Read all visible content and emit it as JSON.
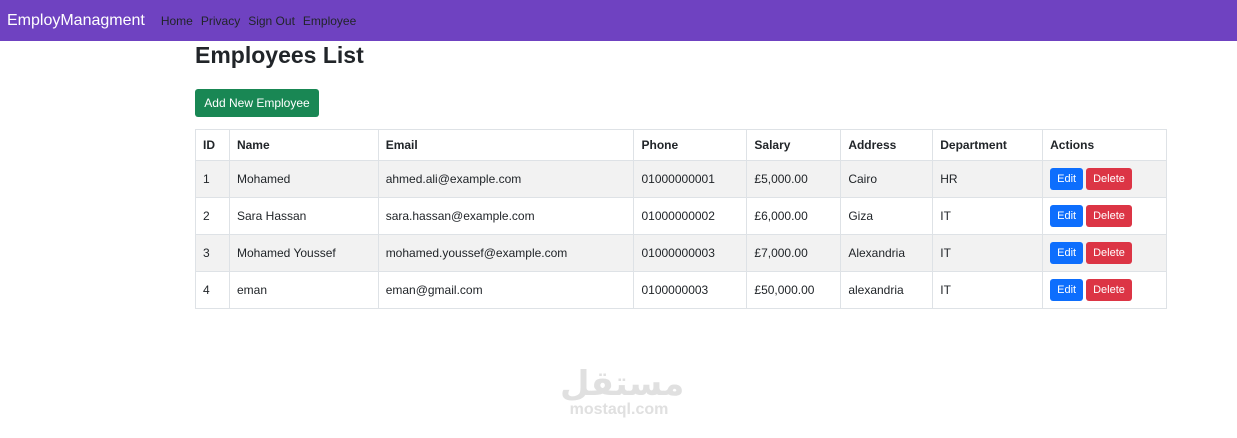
{
  "navbar": {
    "brand": "EmployManagment",
    "links": [
      "Home",
      "Privacy",
      "Sign Out",
      "Employee"
    ]
  },
  "page": {
    "title": "Employees List",
    "add_button": "Add New Employee"
  },
  "table": {
    "headers": [
      "ID",
      "Name",
      "Email",
      "Phone",
      "Salary",
      "Address",
      "Department",
      "Actions"
    ],
    "rows": [
      {
        "id": "1",
        "name": "Mohamed",
        "email": "ahmed.ali@example.com",
        "phone": "01000000001",
        "salary": "£5,000.00",
        "address": "Cairo",
        "department": "HR"
      },
      {
        "id": "2",
        "name": "Sara Hassan",
        "email": "sara.hassan@example.com",
        "phone": "01000000002",
        "salary": "£6,000.00",
        "address": "Giza",
        "department": "IT"
      },
      {
        "id": "3",
        "name": "Mohamed Youssef",
        "email": "mohamed.youssef@example.com",
        "phone": "01000000003",
        "salary": "£7,000.00",
        "address": "Alexandria",
        "department": "IT"
      },
      {
        "id": "4",
        "name": "eman",
        "email": "eman@gmail.com",
        "phone": "0100000003",
        "salary": "£50,000.00",
        "address": "alexandria",
        "department": "IT"
      }
    ],
    "edit_label": "Edit",
    "delete_label": "Delete"
  },
  "watermark": {
    "logo": "مستقل",
    "text": "mostaql.com"
  },
  "colors": {
    "navbar": "#6f42c1",
    "add_button": "#198754",
    "edit_button": "#0d6efd",
    "delete_button": "#dc3545",
    "row_stripe": "#f2f2f2"
  }
}
